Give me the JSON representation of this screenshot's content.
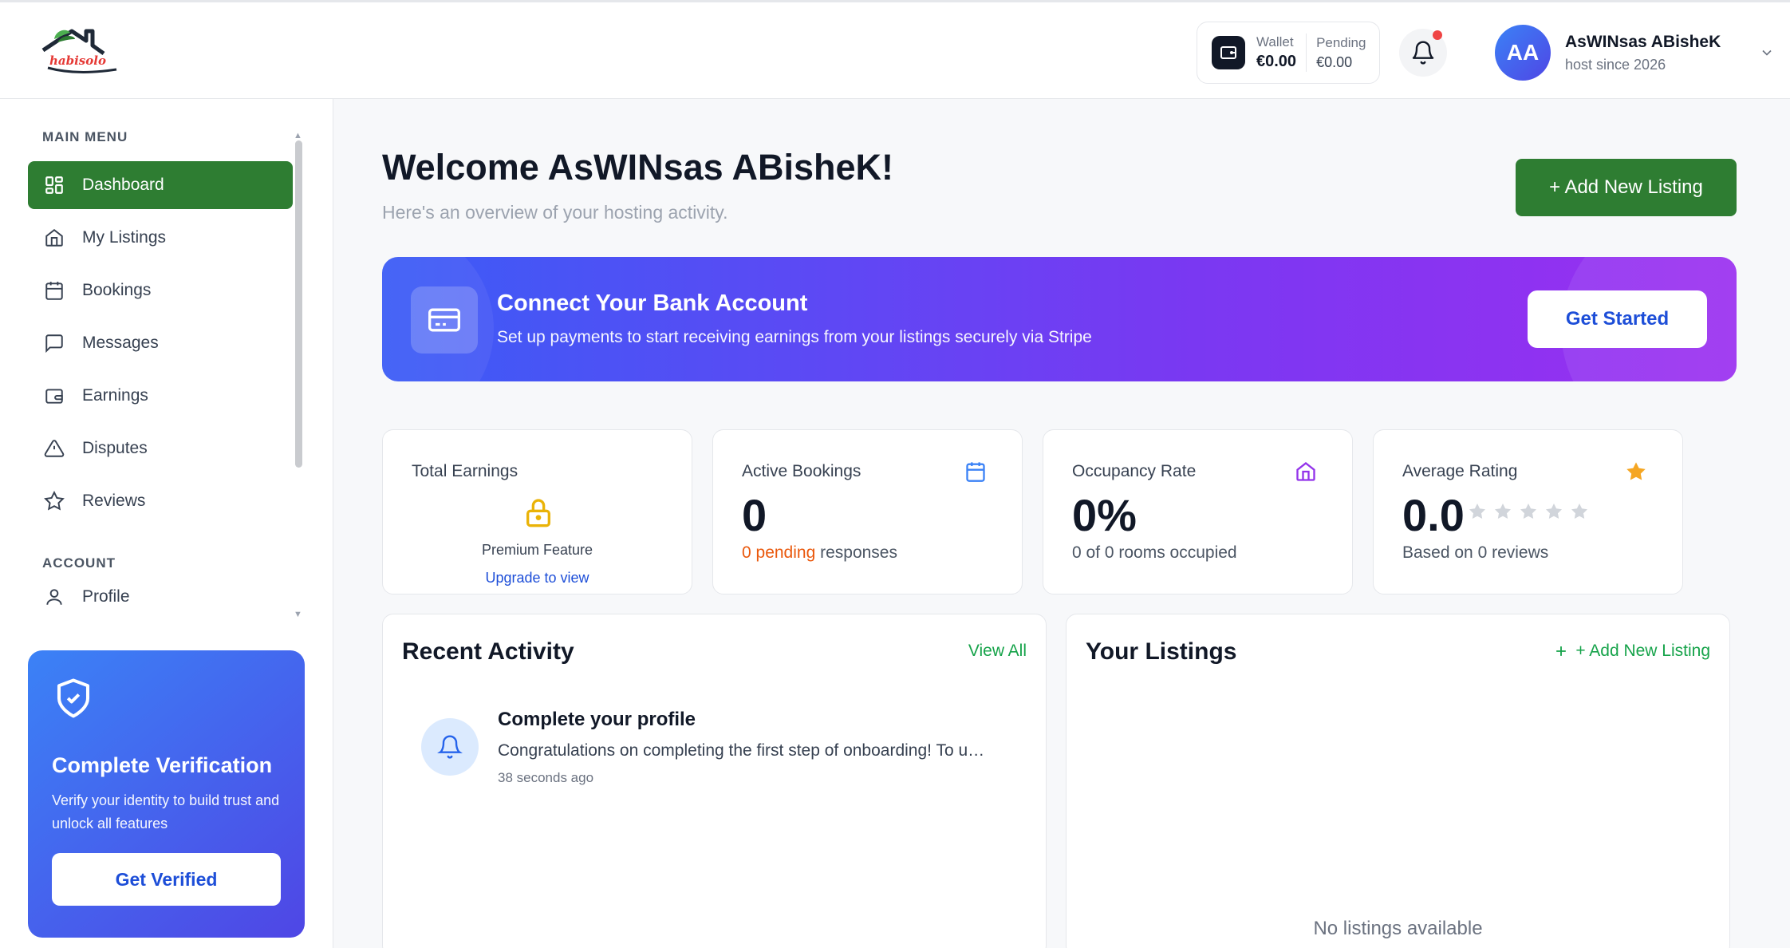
{
  "header": {
    "logo_text": "habisolo",
    "wallet": {
      "label": "Wallet",
      "value": "€0.00"
    },
    "pending": {
      "label": "Pending",
      "value": "€0.00"
    },
    "user": {
      "initials": "AA",
      "name": "AsWINsas ABisheK",
      "subtitle": "host since 2026"
    }
  },
  "sidebar": {
    "main_menu_title": "MAIN MENU",
    "items": [
      {
        "label": "Dashboard",
        "icon": "grid-icon",
        "active": true
      },
      {
        "label": "My Listings",
        "icon": "home-icon"
      },
      {
        "label": "Bookings",
        "icon": "calendar-icon"
      },
      {
        "label": "Messages",
        "icon": "message-icon"
      },
      {
        "label": "Earnings",
        "icon": "wallet-icon"
      },
      {
        "label": "Disputes",
        "icon": "warning-icon"
      },
      {
        "label": "Reviews",
        "icon": "star-icon"
      }
    ],
    "account_title": "ACCOUNT",
    "account_items": [
      {
        "label": "Profile",
        "icon": "user-icon"
      }
    ],
    "verify": {
      "title": "Complete Verification",
      "desc": "Verify your identity to build trust and unlock all features",
      "button": "Get Verified"
    }
  },
  "main": {
    "welcome": "Welcome AsWINsas ABisheK!",
    "subtitle": "Here's an overview of your hosting activity.",
    "add_listing": "+ Add New Listing",
    "bank": {
      "title": "Connect Your Bank Account",
      "desc": "Set up payments to start receiving earnings from your listings securely via Stripe",
      "button": "Get Started"
    },
    "stats": {
      "earnings": {
        "label": "Total Earnings",
        "premium": "Premium Feature",
        "upgrade": "Upgrade to view"
      },
      "bookings": {
        "label": "Active Bookings",
        "value": "0",
        "pending": "0 pending",
        "suffix": " responses"
      },
      "occupancy": {
        "label": "Occupancy Rate",
        "value": "0%",
        "foot": "0 of 0 rooms occupied"
      },
      "rating": {
        "label": "Average Rating",
        "value": "0.0",
        "stars": 0,
        "foot": "Based on 0 reviews"
      }
    },
    "activity": {
      "title": "Recent Activity",
      "link": "View All",
      "items": [
        {
          "title": "Complete your profile",
          "desc": "Congratulations on completing the first step of onboarding! To unlock all features, please complete your profile.",
          "time": "38 seconds ago"
        }
      ]
    },
    "listings": {
      "title": "Your Listings",
      "link": "+ Add New Listing",
      "empty": "No listings available"
    }
  },
  "colors": {
    "brand_green": "#2e7d32",
    "accent_blue": "#1d4ed8",
    "pending_orange": "#ea580c",
    "star": "#f5a623"
  }
}
